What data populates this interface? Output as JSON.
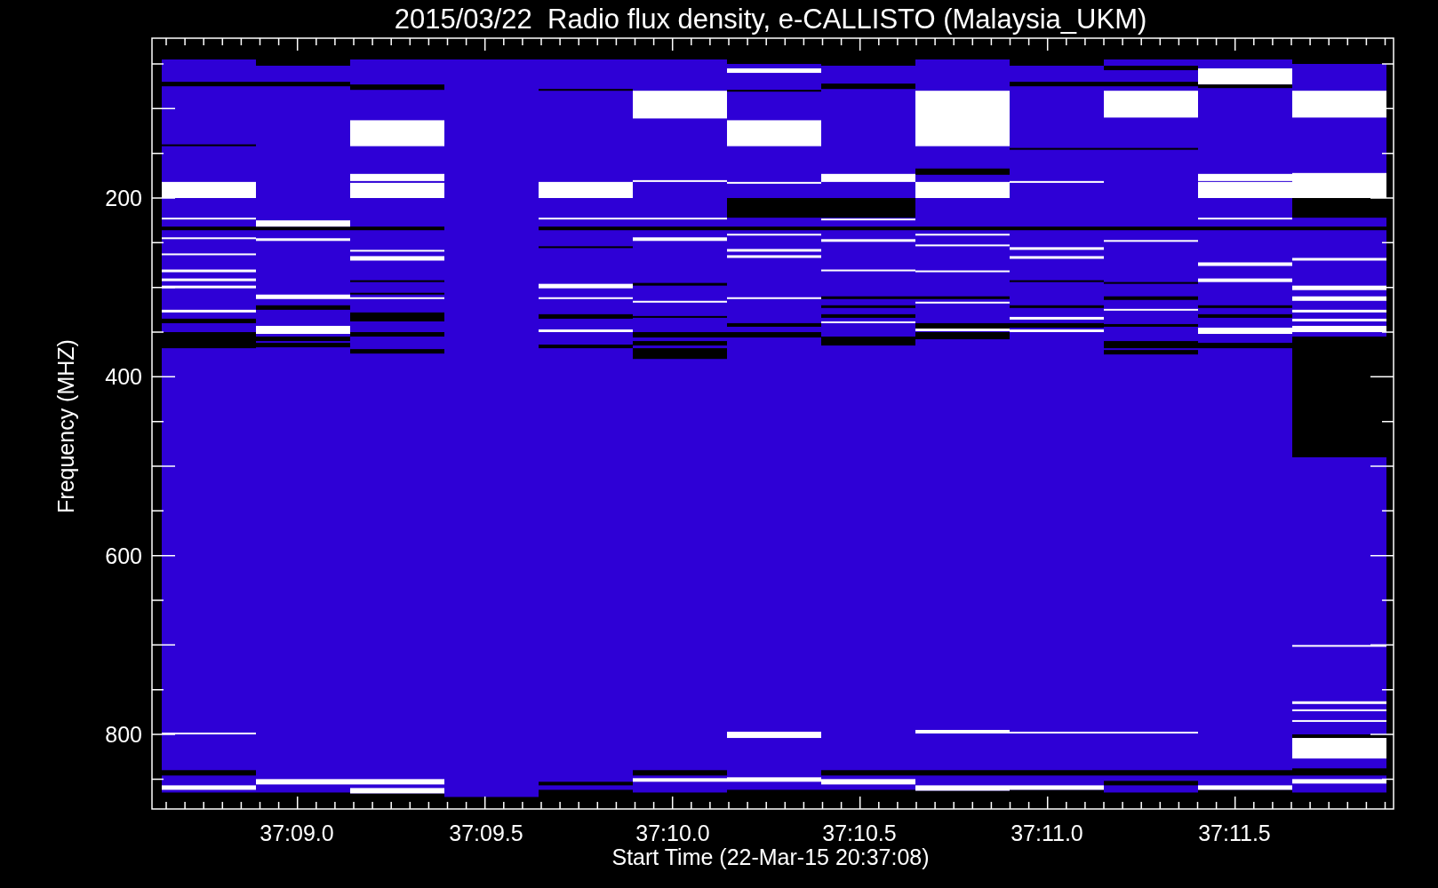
{
  "title": "2015/03/22  Radio flux density, e-CALLISTO (Malaysia_UKM)",
  "yaxis": {
    "label": "Frequency (MHZ)",
    "ticks": [
      "200",
      "400",
      "600",
      "800"
    ]
  },
  "xaxis": {
    "label": "Start Time (22-Mar-15 20:37:08)",
    "ticks": [
      "37:09.0",
      "37:09.5",
      "37:10.0",
      "37:10.5",
      "37:11.0",
      "37:11.5"
    ]
  }
}
